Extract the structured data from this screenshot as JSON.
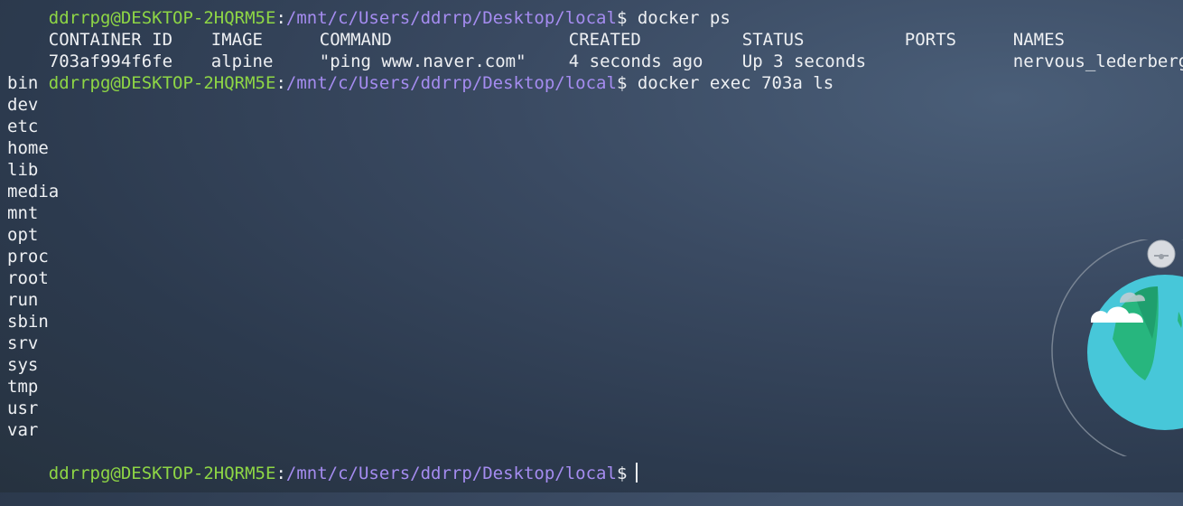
{
  "prompt": {
    "user_host": "ddrrpg@DESKTOP-2HQRM5E",
    "separator": ":",
    "path": "/mnt/c/Users/ddrrp/Desktop/local",
    "symbol": "$"
  },
  "commands": {
    "ps": " docker ps",
    "exec": " docker exec 703a ls"
  },
  "ps_table": {
    "headers": [
      "CONTAINER ID",
      "IMAGE",
      "COMMAND",
      "CREATED",
      "STATUS",
      "PORTS",
      "NAMES"
    ],
    "row": [
      "703af994f6fe",
      "alpine",
      "\"ping www.naver.com\"",
      "4 seconds ago",
      "Up 3 seconds",
      "",
      "nervous_lederberg"
    ]
  },
  "ls_output": [
    "bin",
    "dev",
    "etc",
    "home",
    "lib",
    "media",
    "mnt",
    "opt",
    "proc",
    "root",
    "run",
    "sbin",
    "srv",
    "sys",
    "tmp",
    "usr",
    "var"
  ],
  "colors": {
    "user_host": "#8ed645",
    "path": "#a58cf0",
    "text": "#eef0f3"
  }
}
